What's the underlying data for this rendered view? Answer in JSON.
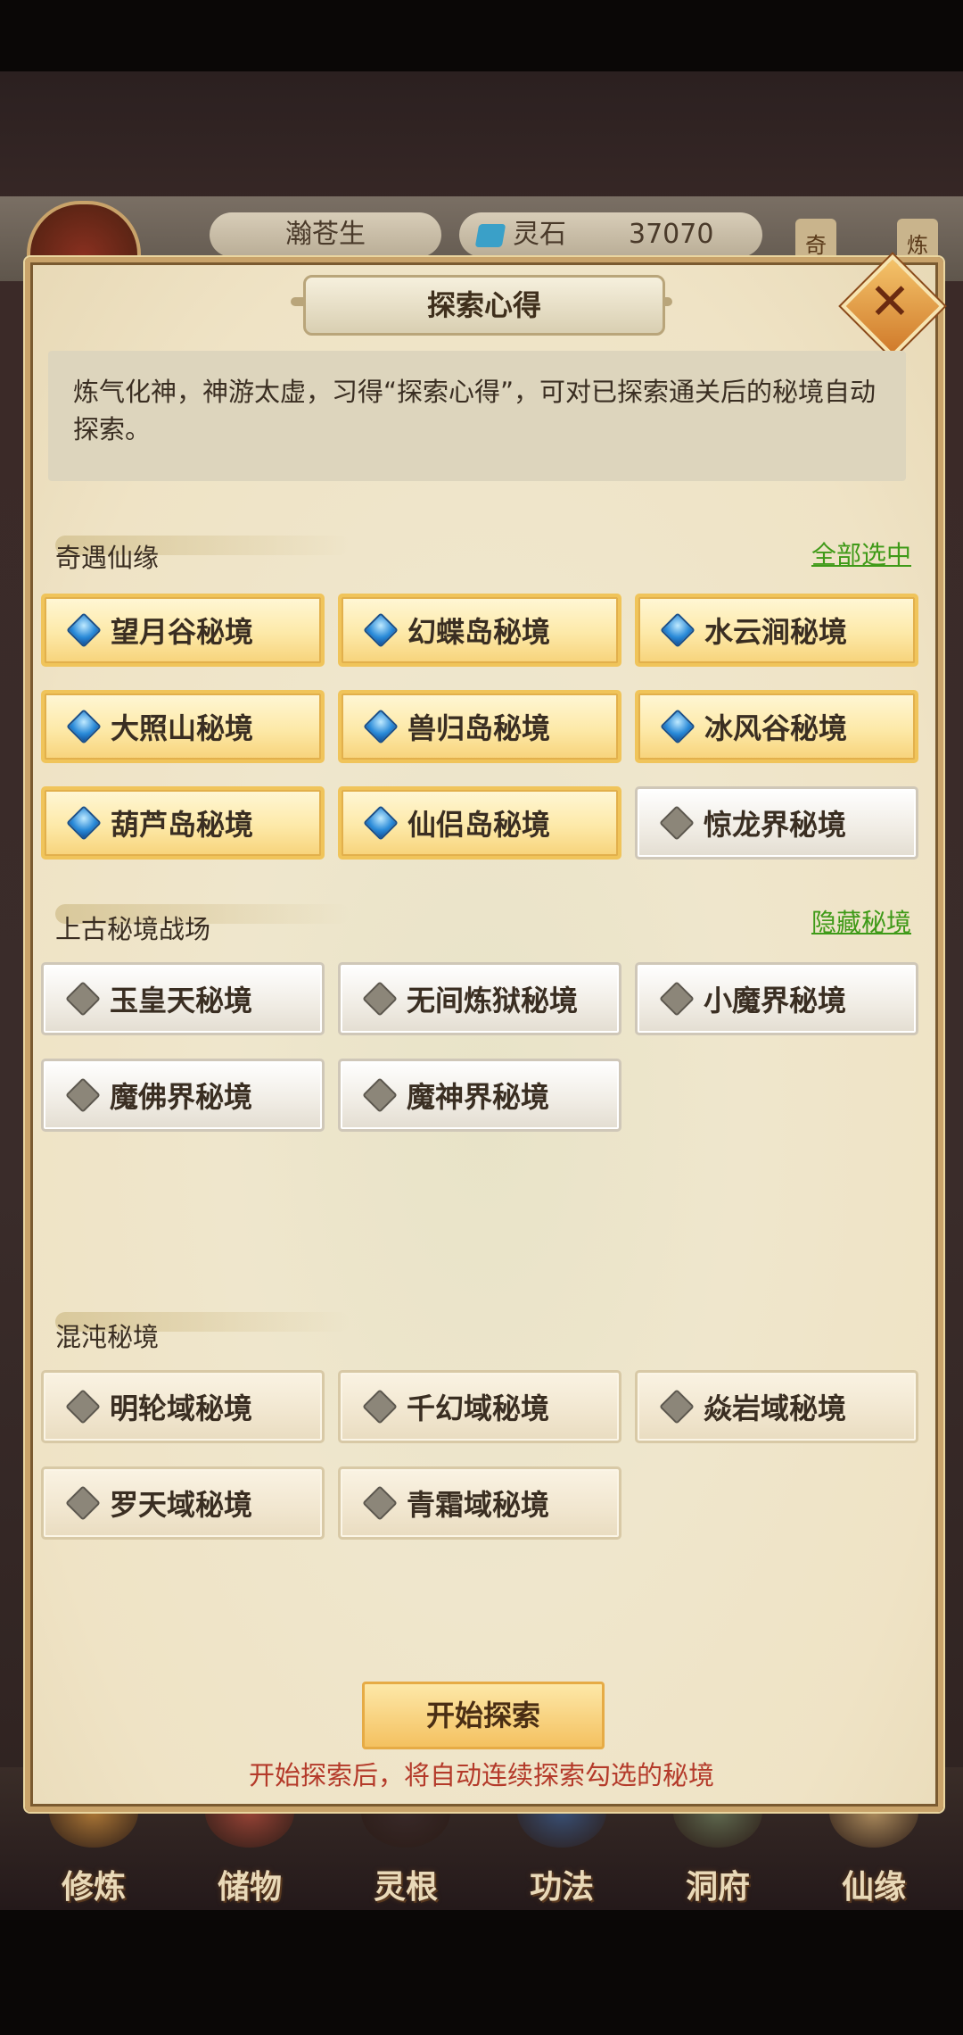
{
  "hud": {
    "player_name": "瀚苍生",
    "currency_label": "灵石",
    "currency_value": "37070",
    "right_btn_1": "奇",
    "right_btn_2": "炼"
  },
  "dialog": {
    "title": "探索心得",
    "close_icon": "close-icon",
    "description": "炼气化神，神游太虚，习得“探索心得”，可对已探索通关后的秘境自动探索。"
  },
  "sections": [
    {
      "title": "奇遇仙缘",
      "link": "全部选中",
      "items": [
        {
          "label": "望月谷秘境",
          "state": "selected"
        },
        {
          "label": "幻蝶岛秘境",
          "state": "selected"
        },
        {
          "label": "水云涧秘境",
          "state": "selected"
        },
        {
          "label": "大照山秘境",
          "state": "selected"
        },
        {
          "label": "兽归岛秘境",
          "state": "selected"
        },
        {
          "label": "冰风谷秘境",
          "state": "selected"
        },
        {
          "label": "葫芦岛秘境",
          "state": "selected"
        },
        {
          "label": "仙侣岛秘境",
          "state": "selected"
        },
        {
          "label": "惊龙界秘境",
          "state": "unselected"
        }
      ]
    },
    {
      "title": "上古秘境战场",
      "link": "隐藏秘境",
      "items": [
        {
          "label": "玉皇天秘境",
          "state": "unselected"
        },
        {
          "label": "无间炼狱秘境",
          "state": "unselected"
        },
        {
          "label": "小魔界秘境",
          "state": "unselected"
        },
        {
          "label": "魔佛界秘境",
          "state": "unselected"
        },
        {
          "label": "魔神界秘境",
          "state": "unselected"
        }
      ]
    },
    {
      "title": "混沌秘境",
      "items": [
        {
          "label": "明轮域秘境",
          "state": "locked"
        },
        {
          "label": "千幻域秘境",
          "state": "locked"
        },
        {
          "label": "焱岩域秘境",
          "state": "locked"
        },
        {
          "label": "罗天域秘境",
          "state": "locked"
        },
        {
          "label": "青霜域秘境",
          "state": "locked"
        }
      ]
    }
  ],
  "start_button": "开始探索",
  "hint": "开始探索后，将自动连续探索勾选的秘境",
  "bottom_nav": [
    "修炼",
    "储物",
    "灵根",
    "功法",
    "洞府",
    "仙缘"
  ],
  "colors": {
    "selected_bg": "#fde9a8",
    "link_green": "#3f9a18",
    "hint_red": "#b43a2a",
    "diamond_blue": "#2a8ad8"
  }
}
